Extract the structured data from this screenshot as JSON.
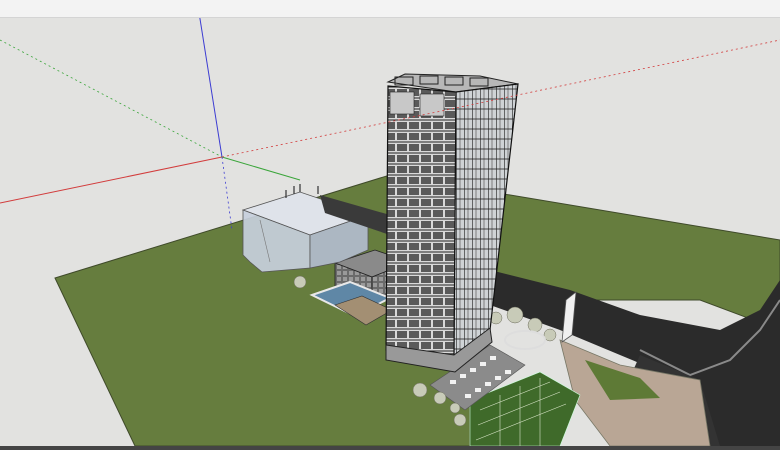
{
  "app": {
    "title": ""
  },
  "scene": {
    "description_icon": "3d-model-viewport",
    "colors": {
      "sky": "#e2e2e0",
      "ground": "#667d3e",
      "road": "#2b2b2b",
      "plaza": "#b9a695",
      "axis_red": "#d23c3c",
      "axis_green": "#3aa53a",
      "axis_blue": "#3c3cd2"
    }
  }
}
